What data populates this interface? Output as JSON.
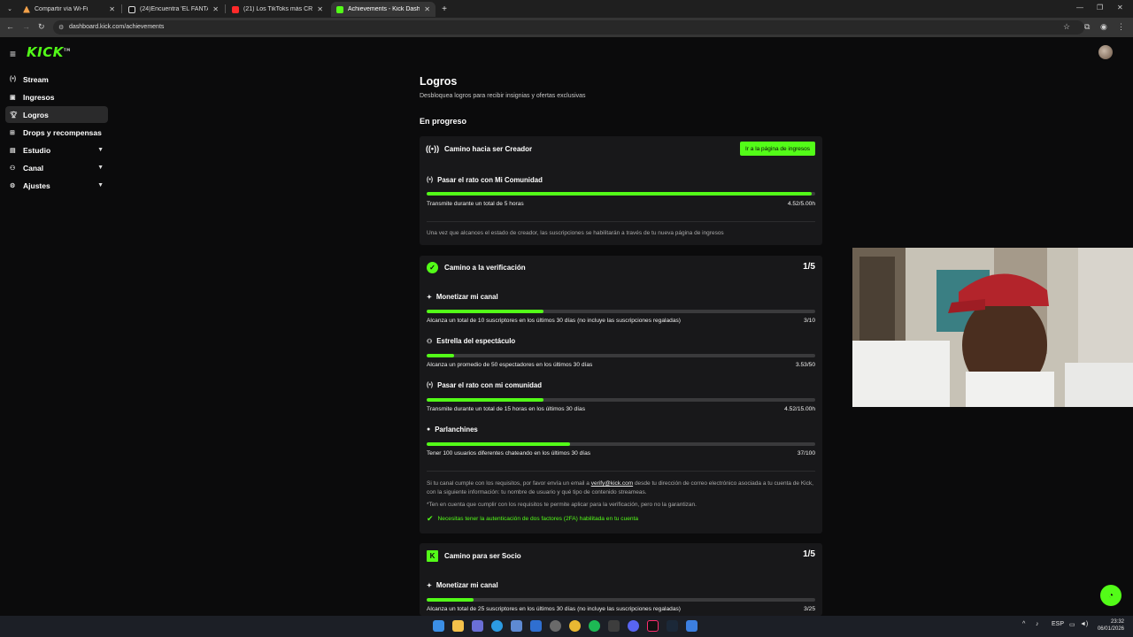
{
  "browser": {
    "tabs": [
      {
        "title": "Compartir vía Wi-Fi",
        "color": "#f3a14a"
      },
      {
        "title": "(24)Encuentra 'EL FANTASMA C",
        "color": "#ffffff"
      },
      {
        "title": "(21) Los TikToks más CRINGE !!",
        "color": "#ff2a2a"
      },
      {
        "title": "Achievements - Kick Dashboard",
        "color": "#53fc18"
      }
    ],
    "url": "dashboard.kick.com/achievements"
  },
  "brand": {
    "logo": "KICK",
    "accent": "#53fc18"
  },
  "sidebar": {
    "items": [
      {
        "label": "Stream",
        "icon": "broadcast-icon"
      },
      {
        "label": "Ingresos",
        "icon": "wallet-icon"
      },
      {
        "label": "Logros",
        "icon": "trophy-icon"
      },
      {
        "label": "Drops y recompensas",
        "icon": "gift-icon"
      },
      {
        "label": "Estudio",
        "icon": "layout-icon"
      },
      {
        "label": "Canal",
        "icon": "users-icon"
      },
      {
        "label": "Ajustes",
        "icon": "gear-icon"
      }
    ]
  },
  "main": {
    "title": "Logros",
    "subtitle": "Desbloquea logros para recibir insignias y ofertas exclusivas",
    "section": "En progreso",
    "creator": {
      "title": "Camino hacia ser Creador",
      "button": "Ir a la página de ingresos",
      "goal": {
        "title": "Pasar el rato con Mi Comunidad",
        "desc": "Transmite durante un total de 5 horas",
        "value": "4.52/5.00h",
        "progress": 0.99
      },
      "note": "Una vez que alcances el estado de creador, las suscripciones se habilitarán a través de tu nueva página de ingresos"
    },
    "verification": {
      "title": "Camino a la verificación",
      "count": "1/5",
      "goals": [
        {
          "title": "Monetizar mi canal",
          "desc": "Alcanza un total de 10 suscriptores en los últimos 30 días (no incluye las suscripciones regaladas)",
          "value": "3/10",
          "progress": 0.3
        },
        {
          "title": "Estrella del espectáculo",
          "desc": "Alcanza un promedio de 50 espectadores en los últimos 30 días",
          "value": "3.53/50",
          "progress": 0.07
        },
        {
          "title": "Pasar el rato con mi comunidad",
          "desc": "Transmite durante un total de 15 horas en los últimos 30 días",
          "value": "4.52/15.00h",
          "progress": 0.3
        },
        {
          "title": "Parlanchines",
          "desc": "Tener 100 usuarios diferentes chateando en los últimos 30 días",
          "value": "37/100",
          "progress": 0.37
        }
      ],
      "note_a": "Si tu canal cumple con los requisitos, por favor envía un email a ",
      "email": "verify@kick.com",
      "note_b": " desde tu dirección de correo electrónico asociada a tu cuenta de Kick, con la siguiente información: tu nombre de usuario y qué tipo de contenido streameas.",
      "note2": "*Ten en cuenta que cumplir con los requisitos te permite aplicar para la verificación, pero no la garantizan.",
      "check": "Necesitas tener la autenticación de dos factores (2FA) habilitada en tu cuenta"
    },
    "partner": {
      "title": "Camino para ser Socio",
      "count": "1/5",
      "goal": {
        "title": "Monetizar mi canal",
        "desc": "Alcanza un total de 25 suscriptores en los últimos 30 días (no incluye las suscripciones regaladas)",
        "value": "3/25",
        "progress": 0.12
      }
    }
  },
  "taskbar": {
    "lang": "ESP",
    "time": "23:32",
    "date": "06/01/2026"
  }
}
